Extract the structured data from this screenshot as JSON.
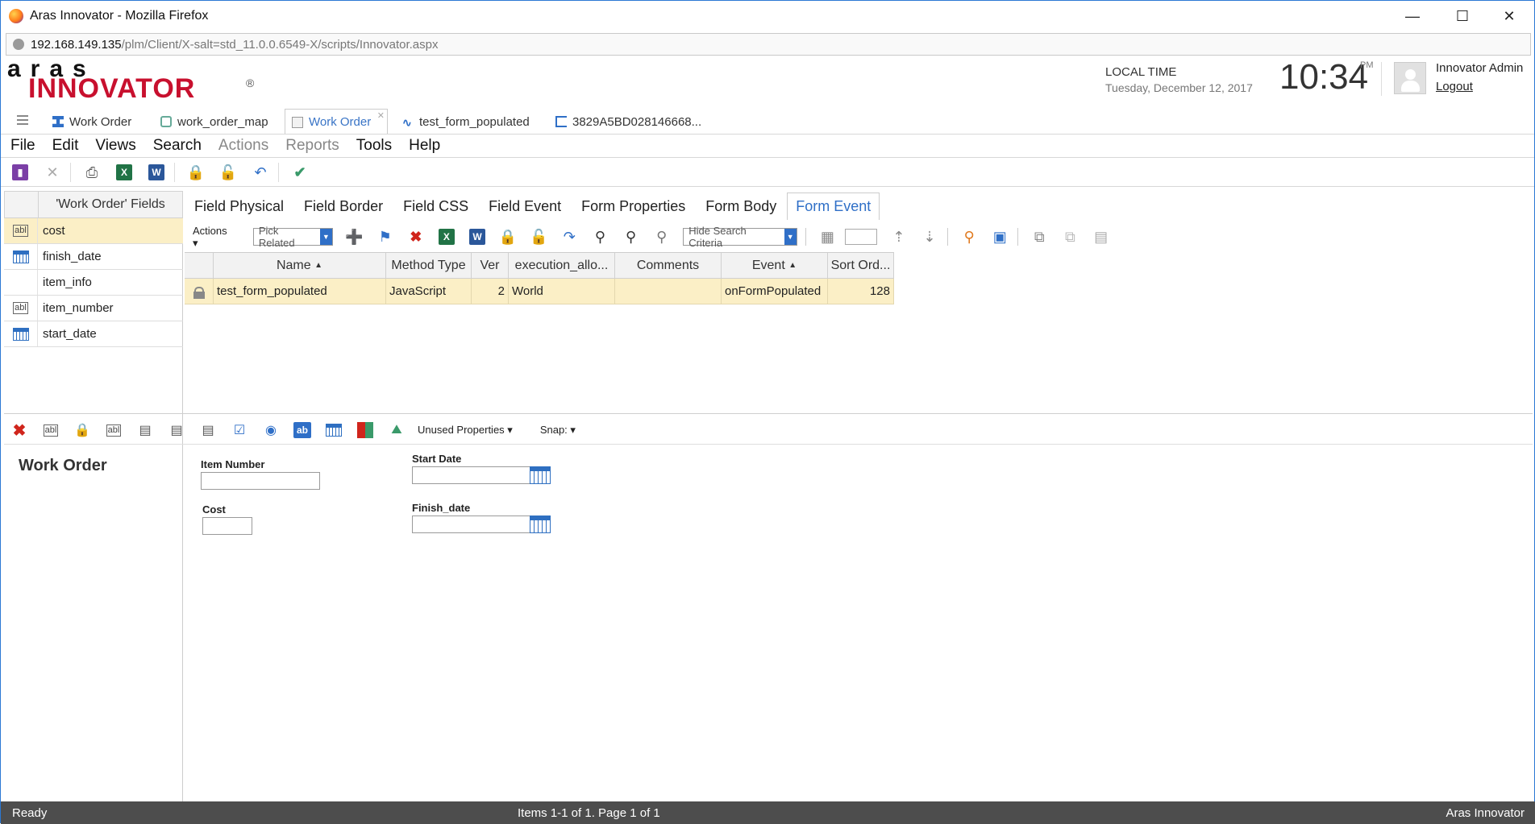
{
  "browser": {
    "title": "Aras Innovator - Mozilla Firefox",
    "url_host": "192.168.149.135",
    "url_path": "/plm/Client/X-salt=std_11.0.0.6549-X/scripts/Innovator.aspx"
  },
  "header": {
    "logo_top": "aras",
    "logo_bottom": "INNOVATOR",
    "logo_reg": "®",
    "local_time_label": "LOCAL TIME",
    "date": "Tuesday, December 12, 2017",
    "time": "10:34",
    "ampm": "PM",
    "user": "Innovator Admin",
    "logout": "Logout"
  },
  "doc_tabs": [
    {
      "label": "Work Order",
      "icon": "item-type-icon"
    },
    {
      "label": "work_order_map",
      "icon": "map-icon"
    },
    {
      "label": "Work Order",
      "icon": "form-icon",
      "active": true
    },
    {
      "label": "test_form_populated",
      "icon": "method-icon"
    },
    {
      "label": "3829A5BD028146668...",
      "icon": "tree-icon"
    }
  ],
  "menu": [
    {
      "label": "File",
      "enabled": true
    },
    {
      "label": "Edit",
      "enabled": true
    },
    {
      "label": "Views",
      "enabled": true
    },
    {
      "label": "Search",
      "enabled": true
    },
    {
      "label": "Actions",
      "enabled": false
    },
    {
      "label": "Reports",
      "enabled": false
    },
    {
      "label": "Tools",
      "enabled": true
    },
    {
      "label": "Help",
      "enabled": true
    }
  ],
  "fields_panel": {
    "header": "'Work Order' Fields",
    "items": [
      {
        "name": "cost",
        "icon": "textbox-icon",
        "selected": true
      },
      {
        "name": "finish_date",
        "icon": "calendar-icon"
      },
      {
        "name": "item_info",
        "icon": ""
      },
      {
        "name": "item_number",
        "icon": "textbox-icon"
      },
      {
        "name": "start_date",
        "icon": "calendar-icon"
      }
    ]
  },
  "right_tabs": [
    {
      "label": "Field Physical"
    },
    {
      "label": "Field Border"
    },
    {
      "label": "Field CSS"
    },
    {
      "label": "Field Event"
    },
    {
      "label": "Form Properties"
    },
    {
      "label": "Form Body"
    },
    {
      "label": "Form Event",
      "active": true
    }
  ],
  "grid_toolbar": {
    "actions": "Actions",
    "pick_related": "Pick Related",
    "hide_search": "Hide Search Criteria"
  },
  "grid": {
    "columns": [
      "",
      "Name",
      "Method Type",
      "Ver",
      "execution_allo...",
      "Comments",
      "Event",
      "Sort Ord..."
    ],
    "rows": [
      {
        "name": "test_form_populated",
        "method_type": "JavaScript",
        "ver": "2",
        "execution": "World",
        "comments": "",
        "event": "onFormPopulated",
        "sort": "128"
      }
    ]
  },
  "form_designer": {
    "unused_properties": "Unused Properties",
    "snap": "Snap:",
    "title": "Work Order",
    "fields": {
      "item_number": "Item Number",
      "cost": "Cost",
      "start_date": "Start Date",
      "finish_date": "Finish_date"
    }
  },
  "status": {
    "left": "Ready",
    "center": "Items 1-1 of 1. Page 1 of 1",
    "right": "Aras Innovator"
  }
}
